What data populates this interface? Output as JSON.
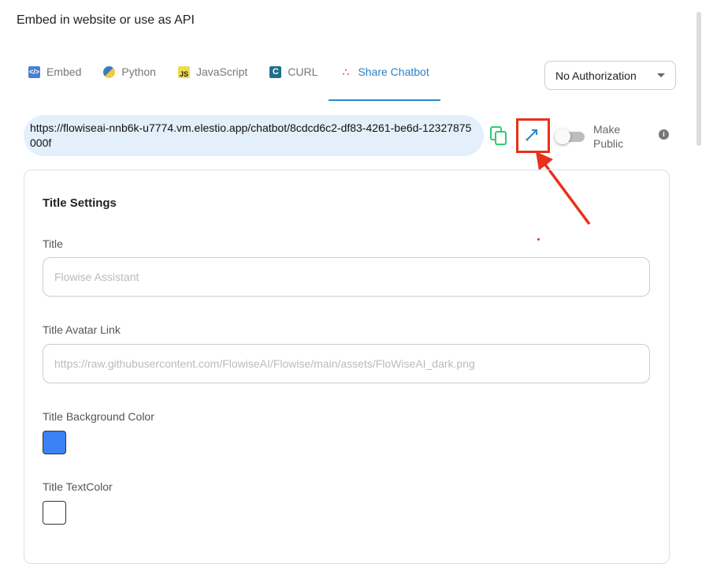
{
  "dialog": {
    "title": "Embed in website or use as API"
  },
  "tabs": [
    {
      "label": "Embed",
      "icon": "code-icon"
    },
    {
      "label": "Python",
      "icon": "python-icon"
    },
    {
      "label": "JavaScript",
      "icon": "javascript-icon"
    },
    {
      "label": "CURL",
      "icon": "curl-icon"
    },
    {
      "label": "Share Chatbot",
      "icon": "share-icon",
      "active": true
    }
  ],
  "auth_select": {
    "value": "No Authorization"
  },
  "share": {
    "url": "https://flowiseai-nnb6k-u7774.vm.elestio.app/chatbot/8cdcd6c2-df83-4261-be6d-12327875000f",
    "make_public_label": "Make Public",
    "make_public": false
  },
  "settings": {
    "heading": "Title Settings",
    "title_label": "Title",
    "title_placeholder": "Flowise Assistant",
    "avatar_label": "Title Avatar Link",
    "avatar_placeholder": "https://raw.githubusercontent.com/FlowiseAI/Flowise/main/assets/FloWiseAI_dark.png",
    "bg_label": "Title Background Color",
    "bg_color": "#3b82f6",
    "text_label": "Title TextColor",
    "text_color": "#ffffff"
  },
  "colors": {
    "accent": "#2e86c9",
    "highlight": "#e8301c"
  }
}
